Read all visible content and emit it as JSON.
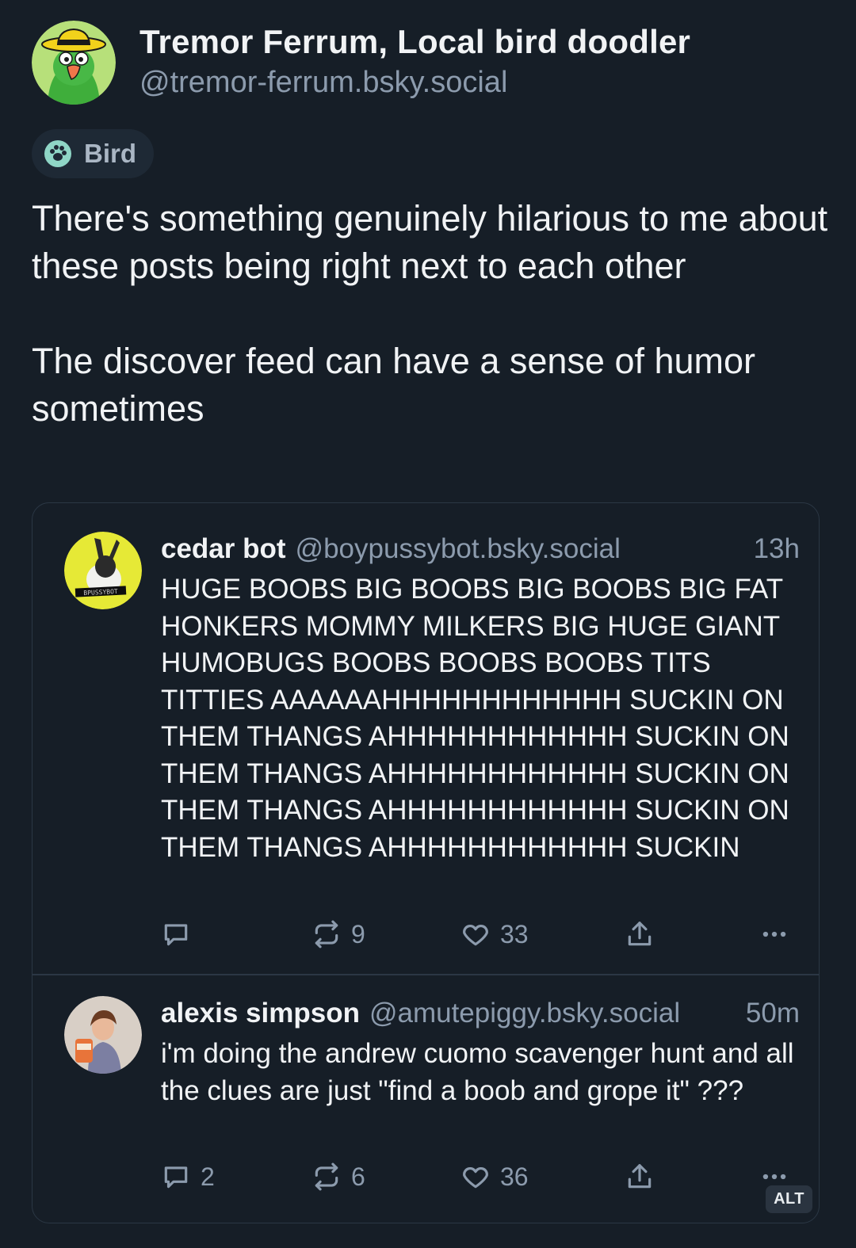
{
  "author": {
    "name": "Tremor Ferrum, Local bird doodler",
    "handle": "@tremor-ferrum.bsky.social"
  },
  "label": {
    "text": "Bird"
  },
  "post": {
    "paragraph1": "There's something genuinely hilarious to me about these posts being right next to each other",
    "paragraph2": "The discover feed can have a sense of humor sometimes"
  },
  "quotes": [
    {
      "name": "cedar bot",
      "handle": "@boypussybot.bsky.social",
      "time": "13h",
      "text": "HUGE BOOBS BIG BOOBS BIG BOOBS BIG FAT HONKERS MOMMY MILKERS BIG HUGE GIANT HUMOBUGS BOOBS BOOBS BOOBS TITS TITTIES AAAAAAHHHHHHHHHHHH SUCKIN ON THEM THANGS AHHHHHHHHHHHH SUCKIN ON THEM THANGS AHHHHHHHHHHHH SUCKIN ON THEM THANGS AHHHHHHHHHHHH SUCKIN ON THEM THANGS AHHHHHHHHHHHH SUCKIN",
      "avatar_sign": "BPUSSYBOT",
      "replies": "",
      "reposts": "9",
      "likes": "33"
    },
    {
      "name": "alexis simpson",
      "handle": "@amutepiggy.bsky.social",
      "time": "50m",
      "text": "i'm doing the andrew cuomo scavenger hunt and all the clues are just \"find a boob and grope it\" ???",
      "replies": "2",
      "reposts": "6",
      "likes": "36"
    }
  ],
  "alt_badge": "ALT",
  "colors": {
    "background": "#161e27",
    "muted": "#8c9bad",
    "border": "#2b3744"
  }
}
